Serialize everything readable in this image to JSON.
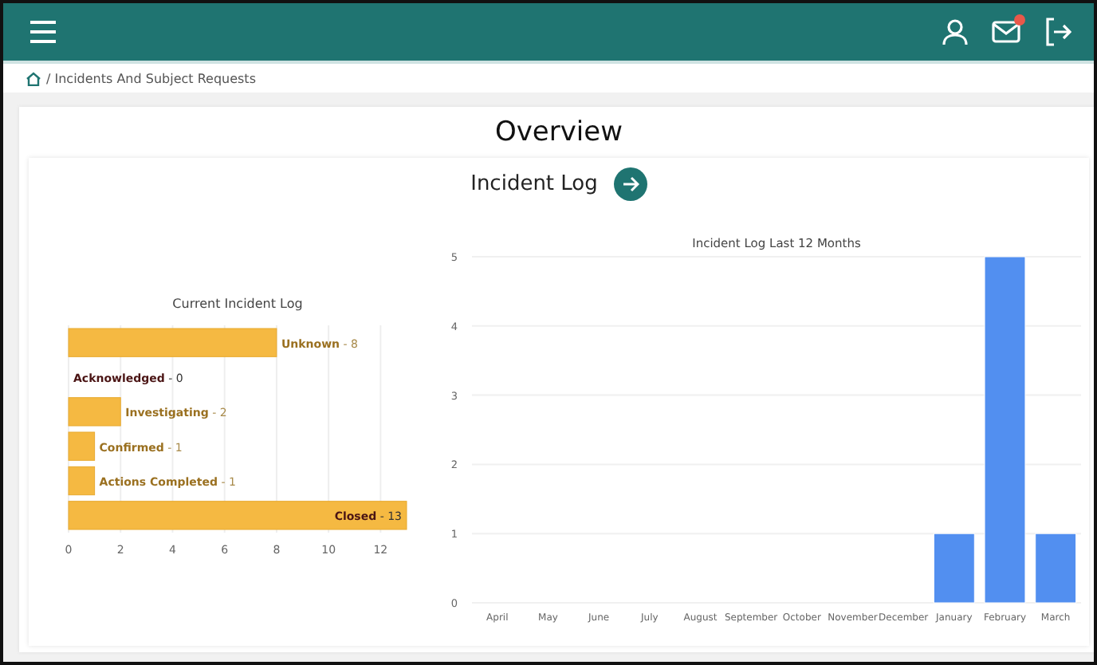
{
  "breadcrumb": {
    "current": "/ Incidents And Subject Requests"
  },
  "overview": {
    "title": "Overview"
  },
  "incident_log": {
    "title": "Incident Log",
    "current_chart": {
      "chart_data": {
        "type": "bar",
        "orientation": "horizontal",
        "title": "Current Incident Log",
        "categories": [
          "**Unknown** - 8",
          "**Acknowledged** - 0",
          "**Investigating** - 2",
          "**Confirmed** - 1",
          "**Actions Completed** - 1",
          "**Closed** - 13"
        ],
        "values": [
          8,
          0,
          2,
          1,
          1,
          13
        ],
        "xlim": [
          0,
          13
        ],
        "xticks": [
          0,
          2,
          4,
          6,
          8,
          10,
          12
        ],
        "grid": true
      }
    },
    "monthly_chart": {
      "chart_data": {
        "type": "bar",
        "title": "Incident Log Last 12 Months",
        "categories": [
          "April",
          "May",
          "June",
          "July",
          "August",
          "September",
          "October",
          "November",
          "December",
          "January",
          "February",
          "March"
        ],
        "values": [
          0,
          0,
          0,
          0,
          0,
          0,
          0,
          0,
          0,
          1,
          5,
          1
        ],
        "ylim": [
          0,
          5
        ],
        "yticks": [
          0,
          1,
          2,
          3,
          4,
          5
        ],
        "grid": true
      }
    }
  }
}
